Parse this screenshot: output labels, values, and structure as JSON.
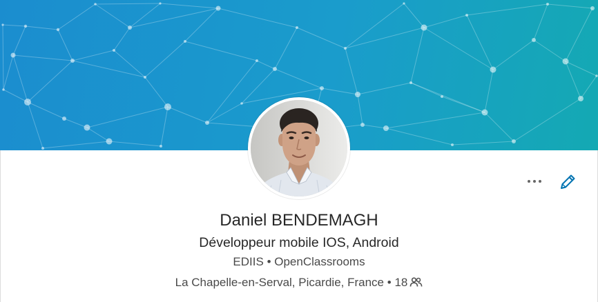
{
  "profile": {
    "name": "Daniel BENDEMAGH",
    "headline": "Développeur mobile IOS, Android",
    "company": "EDIIS",
    "school": "OpenClassrooms",
    "location": "La Chapelle-en-Serval, Picardie, France",
    "connections": "18",
    "separator": "•"
  },
  "icons": {
    "more": "more-horizontal-icon",
    "edit": "pencil-icon",
    "connections": "people-icon"
  },
  "colors": {
    "banner_left": "#1b8dcf",
    "banner_right": "#14a9b3",
    "accent": "#0073b1",
    "text": "#333333",
    "icon": "#666666"
  }
}
